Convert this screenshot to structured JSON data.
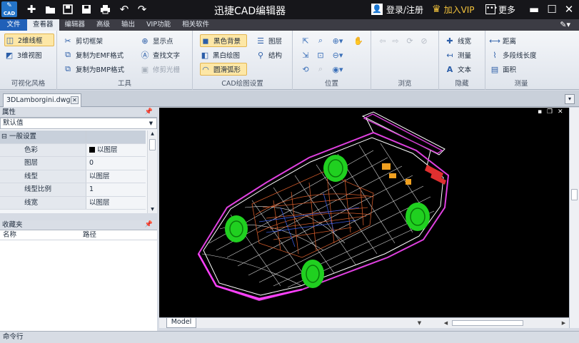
{
  "app": {
    "logo_text": "CAD",
    "title": "迅捷CAD编辑器",
    "login": "登录/注册",
    "vip": "加入VIP",
    "more": "更多",
    "window_buttons": [
      "minimize",
      "maximize",
      "close"
    ]
  },
  "quick_access": [
    "new-file-icon",
    "open-folder-icon",
    "save-icon",
    "save-as-icon",
    "print-icon",
    "undo-icon",
    "redo-icon"
  ],
  "tabs": [
    {
      "label": "文件",
      "active": false,
      "file": true
    },
    {
      "label": "查看器",
      "active": true
    },
    {
      "label": "编辑器",
      "active": false
    },
    {
      "label": "高级",
      "active": false
    },
    {
      "label": "输出",
      "active": false
    },
    {
      "label": "VIP功能",
      "active": false
    },
    {
      "label": "相关软件",
      "active": false
    }
  ],
  "ribbon": {
    "visual_style": {
      "label": "可视化风格",
      "wire2d": "2维线框",
      "view3d": "3维视图"
    },
    "tools": {
      "label": "工具",
      "clip_frame": "剪切框架",
      "copy_emf": "复制为EMF格式",
      "copy_bmp": "复制为BMP格式",
      "show_points": "显示点",
      "find_text": "查找文字",
      "trim_raster": "修剪光栅"
    },
    "draw_settings": {
      "label": "CAD绘图设置",
      "black_bg": "黑色背景",
      "bw_draw": "黑白绘图",
      "smooth_arc": "圆滑弧形",
      "layers": "图层",
      "structure": "结构"
    },
    "position": {
      "label": "位置"
    },
    "browse": {
      "label": "浏览"
    },
    "hide": {
      "label": "隐藏",
      "line_width": "线宽",
      "measure": "测量",
      "text": "文本"
    },
    "measure": {
      "label": "测量",
      "distance": "距离",
      "polyline_length": "多段线长度",
      "area": "面积"
    }
  },
  "document": {
    "tab": "3DLamborgini.dwg"
  },
  "properties": {
    "title": "属性",
    "selector": "默认值",
    "category": "一般设置",
    "rows": [
      {
        "key": "色彩",
        "value": "以图层",
        "swatch": "#000000"
      },
      {
        "key": "图层",
        "value": "0"
      },
      {
        "key": "线型",
        "value": "以图层"
      },
      {
        "key": "线型比例",
        "value": "1"
      },
      {
        "key": "线宽",
        "value": "以图层"
      }
    ]
  },
  "favorites": {
    "title": "收藏夹",
    "columns": [
      "名称",
      "路径"
    ]
  },
  "canvas": {
    "model_tab": "Model",
    "background": "#000000"
  },
  "command": {
    "label": "命令行"
  }
}
